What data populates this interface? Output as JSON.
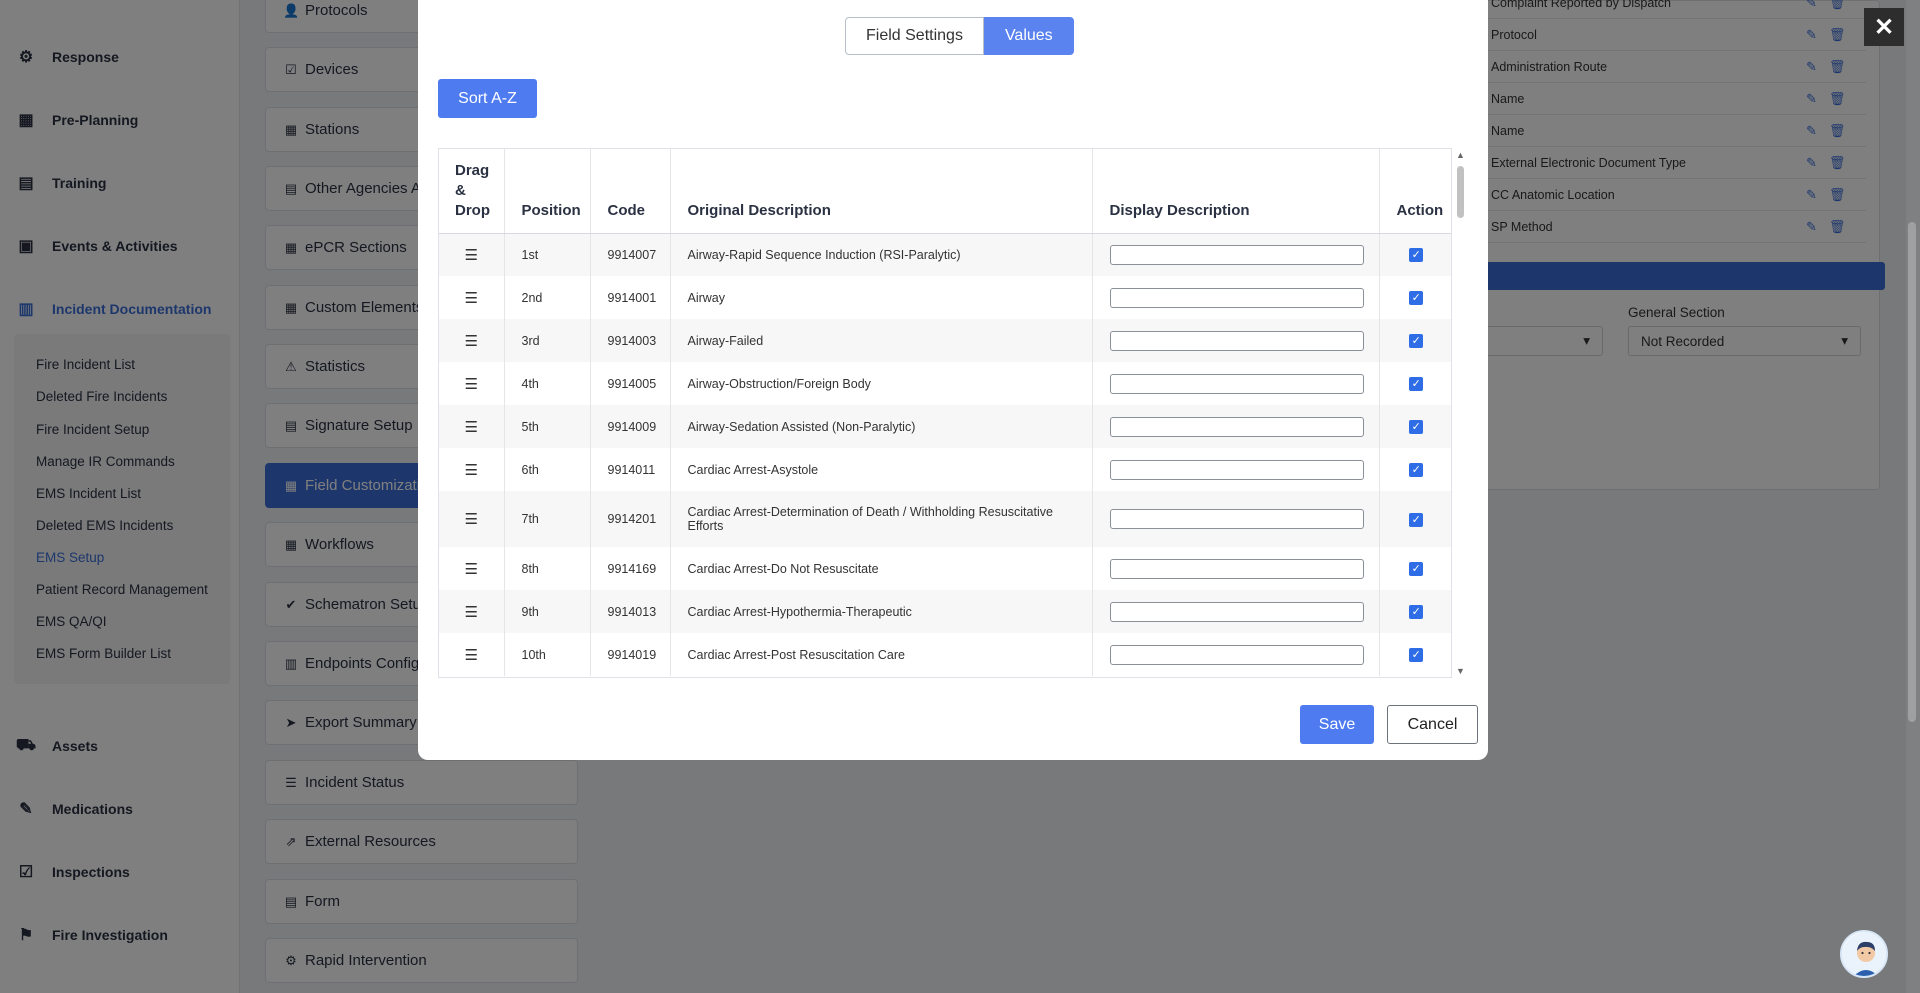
{
  "sidebar": {
    "items": [
      {
        "label": "Response",
        "icon": "response-icon",
        "glyph": "⚙"
      },
      {
        "label": "Pre-Planning",
        "icon": "map-icon",
        "glyph": "▦"
      },
      {
        "label": "Training",
        "icon": "training-icon",
        "glyph": "▤"
      },
      {
        "label": "Events & Activities",
        "icon": "calendar-icon",
        "glyph": "▣"
      },
      {
        "label": "Incident Documentation",
        "icon": "document-icon",
        "glyph": "▥"
      },
      {
        "label": "Assets",
        "icon": "truck-icon",
        "glyph": "⛟"
      },
      {
        "label": "Medications",
        "icon": "syringe-icon",
        "glyph": "✎"
      },
      {
        "label": "Inspections",
        "icon": "checklist-icon",
        "glyph": "☑"
      },
      {
        "label": "Fire Investigation",
        "icon": "investigation-icon",
        "glyph": "⚑"
      }
    ],
    "subitems": [
      "Fire Incident List",
      "Deleted Fire Incidents",
      "Fire Incident Setup",
      "Manage IR Commands",
      "EMS Incident List",
      "Deleted EMS Incidents",
      "EMS Setup",
      "Patient Record Management",
      "EMS QA/QI",
      "EMS Form Builder List"
    ]
  },
  "midcol": {
    "items": [
      {
        "label": "Protocols",
        "glyph": "👤"
      },
      {
        "label": "Devices",
        "glyph": "☑"
      },
      {
        "label": "Stations",
        "glyph": "▦"
      },
      {
        "label": "Other Agencies Av",
        "glyph": "▤"
      },
      {
        "label": "ePCR Sections",
        "glyph": "▦"
      },
      {
        "label": "Custom Elements",
        "glyph": "▦"
      },
      {
        "label": "Statistics",
        "glyph": "⚠"
      },
      {
        "label": "Signature Setup",
        "glyph": "▤"
      },
      {
        "label": "Field Customizati",
        "glyph": "▦"
      },
      {
        "label": "Workflows",
        "glyph": "▦"
      },
      {
        "label": "Schematron Setu",
        "glyph": "✔"
      },
      {
        "label": "Endpoints Config",
        "glyph": "▥"
      },
      {
        "label": "Export Summary",
        "glyph": "➤"
      },
      {
        "label": "Incident Status",
        "glyph": "☰"
      },
      {
        "label": "External Resources",
        "glyph": "⇗"
      },
      {
        "label": "Form",
        "glyph": "▤"
      },
      {
        "label": "Rapid Intervention",
        "glyph": "⚙"
      }
    ]
  },
  "background_panel": {
    "rows": [
      "Complaint Reported by Dispatch",
      "Protocol",
      "Administration Route",
      "Name",
      "Name",
      "External Electronic Document Type",
      "CC Anatomic Location",
      "SP Method"
    ],
    "general_section_label": "General Section",
    "general_section_value": "Not Recorded"
  },
  "modal": {
    "tabs": [
      "Field Settings",
      "Values"
    ],
    "sort_label": "Sort A-Z",
    "columns": {
      "drag": "Drag & Drop",
      "position": "Position",
      "code": "Code",
      "original": "Original Description",
      "display": "Display Description",
      "action": "Action"
    },
    "rows": [
      {
        "position": "1st",
        "code": "9914007",
        "original": "Airway-Rapid Sequence Induction (RSI-Paralytic)",
        "display": "",
        "checked": true
      },
      {
        "position": "2nd",
        "code": "9914001",
        "original": "Airway",
        "display": "",
        "checked": true
      },
      {
        "position": "3rd",
        "code": "9914003",
        "original": "Airway-Failed",
        "display": "",
        "checked": true
      },
      {
        "position": "4th",
        "code": "9914005",
        "original": "Airway-Obstruction/Foreign Body",
        "display": "",
        "checked": true
      },
      {
        "position": "5th",
        "code": "9914009",
        "original": "Airway-Sedation Assisted (Non-Paralytic)",
        "display": "",
        "checked": true
      },
      {
        "position": "6th",
        "code": "9914011",
        "original": "Cardiac Arrest-Asystole",
        "display": "",
        "checked": true
      },
      {
        "position": "7th",
        "code": "9914201",
        "original": "Cardiac Arrest-Determination of Death / Withholding Resuscitative Efforts",
        "display": "",
        "checked": true
      },
      {
        "position": "8th",
        "code": "9914169",
        "original": "Cardiac Arrest-Do Not Resuscitate",
        "display": "",
        "checked": true
      },
      {
        "position": "9th",
        "code": "9914013",
        "original": "Cardiac Arrest-Hypothermia-Therapeutic",
        "display": "",
        "checked": true
      },
      {
        "position": "10th",
        "code": "9914019",
        "original": "Cardiac Arrest-Post Resuscitation Care",
        "display": "",
        "checked": true
      }
    ],
    "save_label": "Save",
    "cancel_label": "Cancel"
  },
  "colors": {
    "accent": "#4f7bf0",
    "active_nav": "#3b6fd8",
    "checkbox": "#2f6de6"
  },
  "close_label": "✕"
}
